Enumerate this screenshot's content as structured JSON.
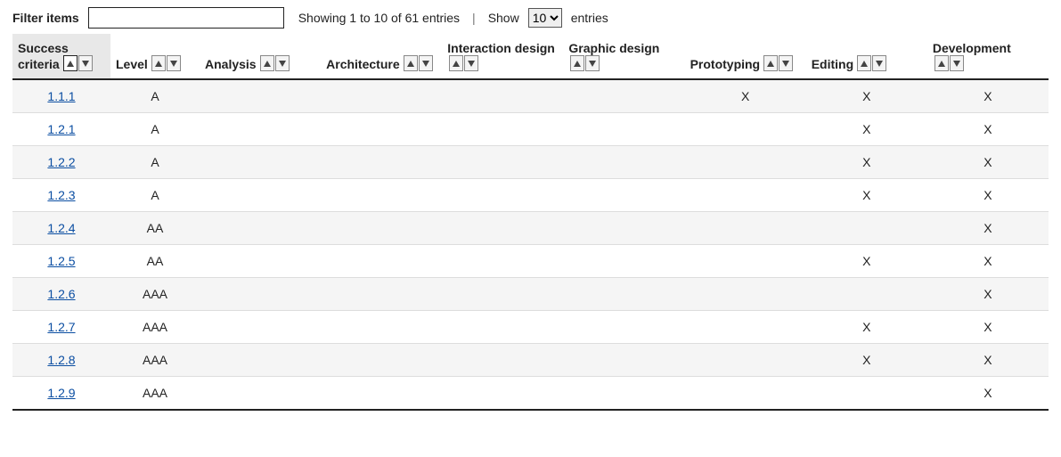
{
  "controls": {
    "filter_label": "Filter items",
    "filter_value": "",
    "showing_text": "Showing 1 to 10 of 61 entries",
    "show_label_before": "Show",
    "show_label_after": "entries",
    "show_value": "10"
  },
  "columns": [
    {
      "key": "sc",
      "label": "Success criteria",
      "sorted": true
    },
    {
      "key": "level",
      "label": "Level",
      "sorted": false
    },
    {
      "key": "analysis",
      "label": "Analysis",
      "sorted": false
    },
    {
      "key": "architecture",
      "label": "Architecture",
      "sorted": false
    },
    {
      "key": "interaction",
      "label": "Interaction design",
      "sorted": false
    },
    {
      "key": "graphic",
      "label": "Graphic design",
      "sorted": false
    },
    {
      "key": "prototyping",
      "label": "Prototyping",
      "sorted": false
    },
    {
      "key": "editing",
      "label": "Editing",
      "sorted": false
    },
    {
      "key": "development",
      "label": "Development",
      "sorted": false
    }
  ],
  "mark": "X",
  "rows": [
    {
      "sc": "1.1.1",
      "level": "A",
      "analysis": "",
      "architecture": "",
      "interaction": "",
      "graphic": "",
      "prototyping": "X",
      "editing": "X",
      "development": "X"
    },
    {
      "sc": "1.2.1",
      "level": "A",
      "analysis": "",
      "architecture": "",
      "interaction": "",
      "graphic": "",
      "prototyping": "",
      "editing": "X",
      "development": "X"
    },
    {
      "sc": "1.2.2",
      "level": "A",
      "analysis": "",
      "architecture": "",
      "interaction": "",
      "graphic": "",
      "prototyping": "",
      "editing": "X",
      "development": "X"
    },
    {
      "sc": "1.2.3",
      "level": "A",
      "analysis": "",
      "architecture": "",
      "interaction": "",
      "graphic": "",
      "prototyping": "",
      "editing": "X",
      "development": "X"
    },
    {
      "sc": "1.2.4",
      "level": "AA",
      "analysis": "",
      "architecture": "",
      "interaction": "",
      "graphic": "",
      "prototyping": "",
      "editing": "",
      "development": "X"
    },
    {
      "sc": "1.2.5",
      "level": "AA",
      "analysis": "",
      "architecture": "",
      "interaction": "",
      "graphic": "",
      "prototyping": "",
      "editing": "X",
      "development": "X"
    },
    {
      "sc": "1.2.6",
      "level": "AAA",
      "analysis": "",
      "architecture": "",
      "interaction": "",
      "graphic": "",
      "prototyping": "",
      "editing": "",
      "development": "X"
    },
    {
      "sc": "1.2.7",
      "level": "AAA",
      "analysis": "",
      "architecture": "",
      "interaction": "",
      "graphic": "",
      "prototyping": "",
      "editing": "X",
      "development": "X"
    },
    {
      "sc": "1.2.8",
      "level": "AAA",
      "analysis": "",
      "architecture": "",
      "interaction": "",
      "graphic": "",
      "prototyping": "",
      "editing": "X",
      "development": "X"
    },
    {
      "sc": "1.2.9",
      "level": "AAA",
      "analysis": "",
      "architecture": "",
      "interaction": "",
      "graphic": "",
      "prototyping": "",
      "editing": "",
      "development": "X"
    }
  ]
}
